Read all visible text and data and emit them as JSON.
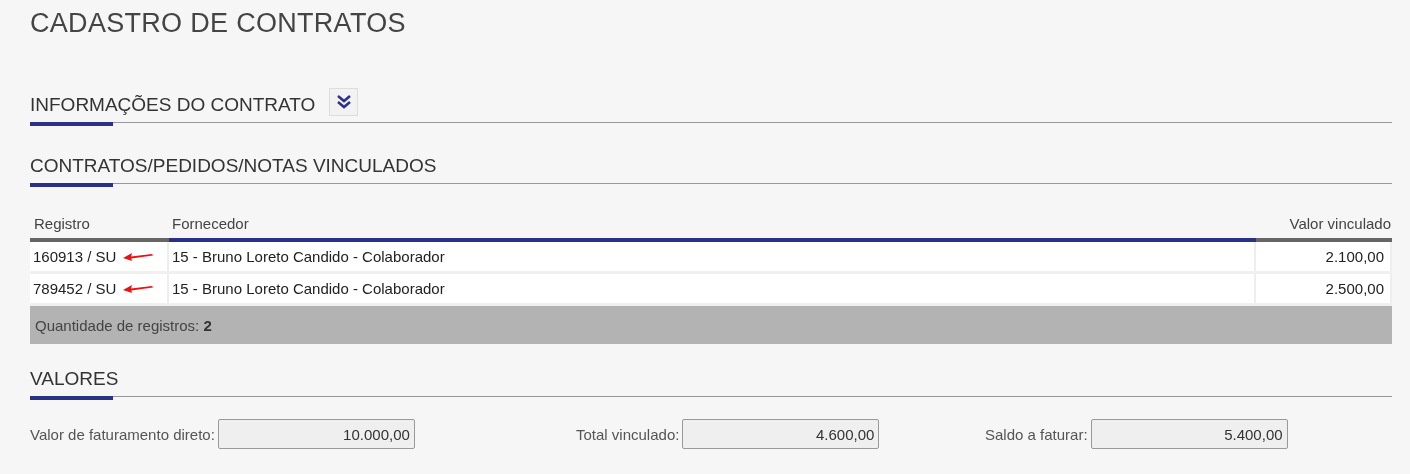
{
  "page_title": "CADASTRO DE CONTRATOS",
  "sections": [
    {
      "title": "INFORMAÇÕES DO CONTRATO",
      "expandable": true
    },
    {
      "title": "CONTRATOS/PEDIDOS/NOTAS VINCULADOS",
      "expandable": false
    }
  ],
  "table": {
    "columns": [
      "Registro",
      "Fornecedor",
      "Valor vinculado"
    ],
    "rows": [
      {
        "registro": "160913 / SU",
        "fornecedor": "15 - Bruno Loreto Candido - Colaborador",
        "valor": "2.100,00"
      },
      {
        "registro": "789452 / SU",
        "fornecedor": "15 - Bruno Loreto Candido - Colaborador",
        "valor": "2.500,00"
      }
    ],
    "footer": "Quantidade de registros: **2**"
  },
  "valores": {
    "title": "VALORES",
    "fields": [
      {
        "label": "Valor de faturamento direto:",
        "value": "10.000,00"
      },
      {
        "label": "Total vinculado:",
        "value": "4.600,00"
      },
      {
        "label": "Saldo a faturar:",
        "value": "5.400,00"
      }
    ]
  }
}
